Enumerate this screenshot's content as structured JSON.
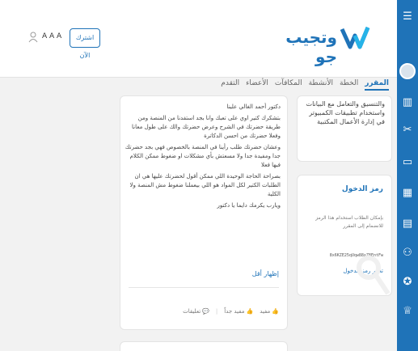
{
  "header": {
    "logo_text": "وتجيب جو",
    "subscribe_label": "اشترك الآن",
    "font_size_label": "A A A"
  },
  "tabs": [
    {
      "label": "المقرر",
      "active": true
    },
    {
      "label": "الخطة",
      "active": false
    },
    {
      "label": "الأنشطة",
      "active": false
    },
    {
      "label": "المكافآت",
      "active": false
    },
    {
      "label": "الأعضاء",
      "active": false
    },
    {
      "label": "التقدم",
      "active": false
    }
  ],
  "post": {
    "paragraphs": [
      "دكتور أحمد الغالي علينا",
      "بتشكرك كتير اوي على تعبك وانا بجد استفدنا من المنصة ومن طريقة حضرتك في الشرح وعرض حضرتك والك على طول معانا وفعلا حضرتك من احسن الدكاترة",
      "وعشان حضرتك طلب رأينا في المنصة بالخصوص فهي بجد حضرتك جدا ومفيدة جدا ولا مسعتش بأي مشكلات او ضغوط ممكن الكلام فيها فعلا",
      "بصراحة الحاجة الوحيدة اللي ممكن أقول لحضرتك عليها هي ان الطلبات الكتير لكل المواد هو اللي بيعملنا ضغوط مش المنصة ولا الكلية",
      "ويارب يكرمك دايما يا دكتور"
    ],
    "show_less": "إظهار أقل",
    "actions": {
      "useful": "مفيد",
      "very_useful": "مفيد جداً",
      "comments": "تعليقات"
    }
  },
  "side_card_1": {
    "text": "والتنسيق والتعامل مع البيانات واستخدام تطبيقات الكمبيوتر في إدارة الأعمال المكتبية"
  },
  "side_card_2": {
    "title": "رمز الدخول",
    "description": "بإمكان الطلاب استخدام هذا الرمز للانضمام إلى المقرر",
    "code": "8x6KZE25qUqw88xZ8EntFw",
    "change_label": "تغيير رمز الدخول"
  },
  "colors": {
    "brand": "#1f73b8",
    "background": "#f2f2f2"
  },
  "rail_icons": [
    "menu-icon",
    "avatar",
    "chart-icon",
    "tools-icon",
    "monitor-icon",
    "calendar-icon",
    "document-icon",
    "people-icon",
    "badge-icon",
    "award-icon"
  ]
}
